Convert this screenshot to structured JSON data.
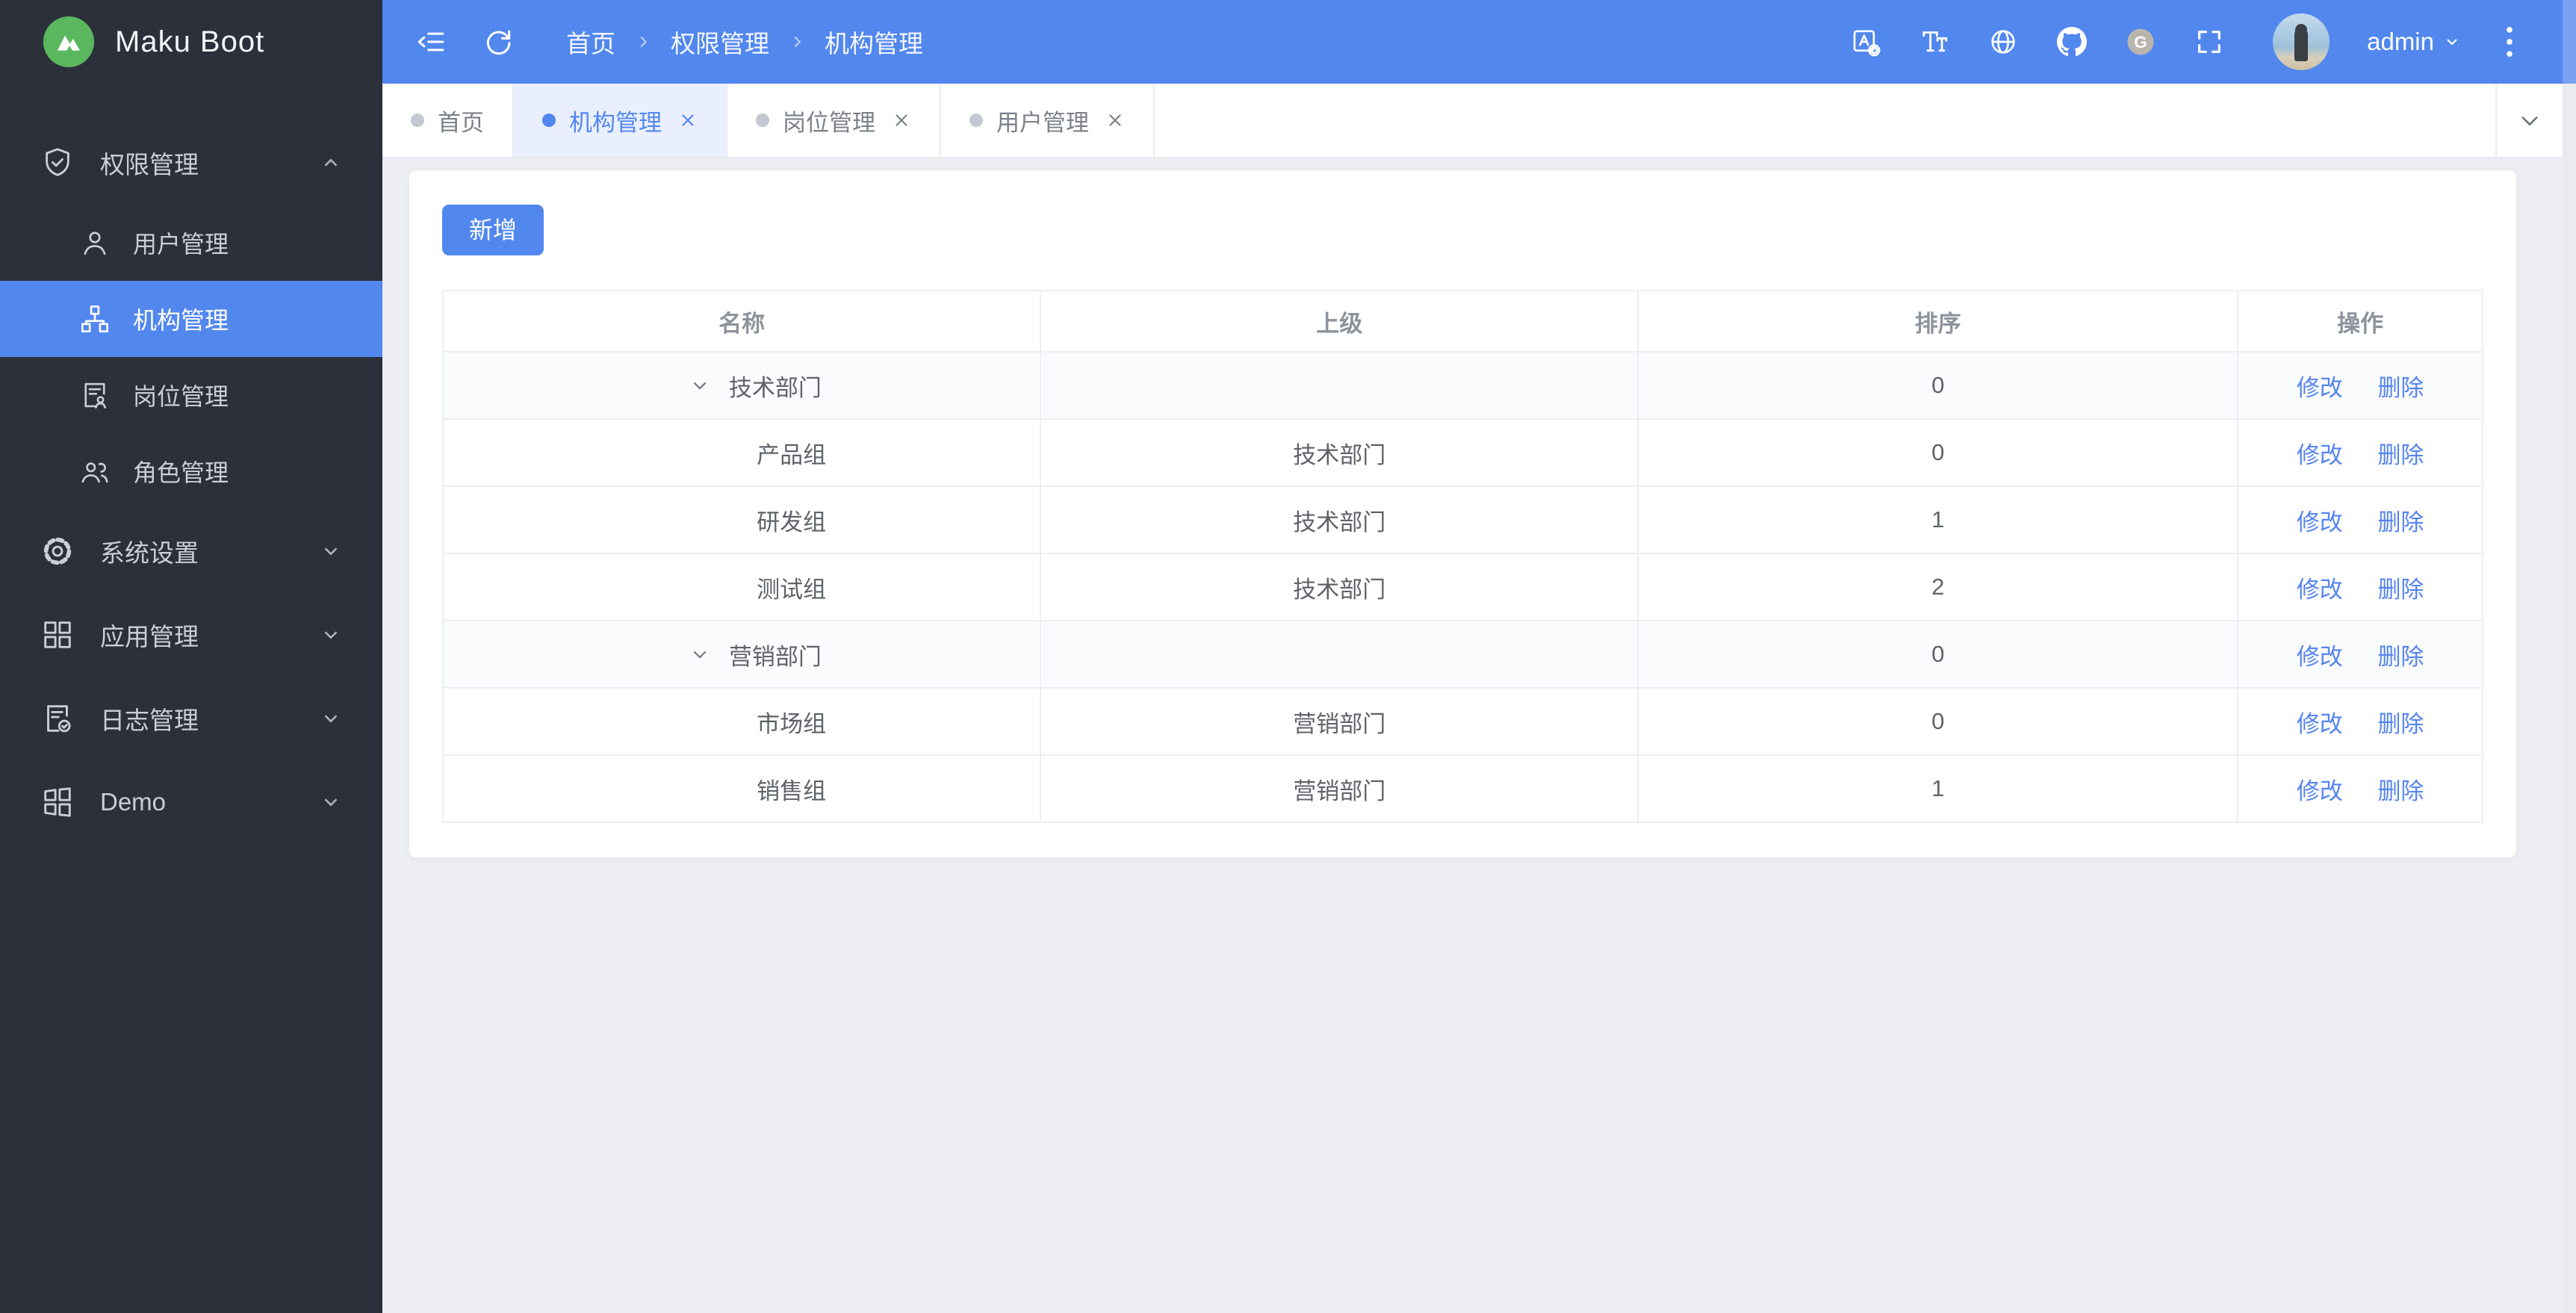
{
  "app": {
    "name": "Maku Boot"
  },
  "colors": {
    "accent": "#5287ee",
    "sidebar_bg": "#2b303b",
    "logo_green": "#5bb75e",
    "gitee_gray": "#b9b5ac",
    "content_bg": "#edeff3"
  },
  "sidebar": {
    "items": [
      {
        "label": "权限管理",
        "icon": "shield-check-icon",
        "expanded": true,
        "children": [
          {
            "label": "用户管理",
            "icon": "user-icon",
            "active": false
          },
          {
            "label": "机构管理",
            "icon": "org-chart-icon",
            "active": true
          },
          {
            "label": "岗位管理",
            "icon": "post-doc-icon",
            "active": false
          },
          {
            "label": "角色管理",
            "icon": "roles-people-icon",
            "active": false
          }
        ]
      },
      {
        "label": "系统设置",
        "icon": "gear-icon",
        "expanded": false
      },
      {
        "label": "应用管理",
        "icon": "grid-icon",
        "expanded": false
      },
      {
        "label": "日志管理",
        "icon": "log-doc-icon",
        "expanded": false
      },
      {
        "label": "Demo",
        "icon": "demo-grid-icon",
        "expanded": false
      }
    ]
  },
  "topbar": {
    "breadcrumb": [
      "首页",
      "权限管理",
      "机构管理"
    ],
    "left_icons": [
      "collapse-menu-icon",
      "refresh-icon"
    ],
    "right_icons": [
      "translate-icon",
      "font-size-icon",
      "globe-icon",
      "github-icon",
      "gitee-icon",
      "fullscreen-icon"
    ],
    "user": {
      "name": "admin"
    }
  },
  "tabs": [
    {
      "label": "首页",
      "active": false,
      "closable": false
    },
    {
      "label": "机构管理",
      "active": true,
      "closable": true
    },
    {
      "label": "岗位管理",
      "active": false,
      "closable": true
    },
    {
      "label": "用户管理",
      "active": false,
      "closable": true
    }
  ],
  "main": {
    "add_button": "新增",
    "table": {
      "headers": [
        "名称",
        "上级",
        "排序",
        "操作"
      ],
      "rows": [
        {
          "name": "技术部门",
          "parent": "",
          "sort": "0",
          "expandable": true,
          "actions": [
            "修改",
            "删除"
          ]
        },
        {
          "name": "产品组",
          "parent": "技术部门",
          "sort": "0",
          "expandable": false,
          "actions": [
            "修改",
            "删除"
          ]
        },
        {
          "name": "研发组",
          "parent": "技术部门",
          "sort": "1",
          "expandable": false,
          "actions": [
            "修改",
            "删除"
          ]
        },
        {
          "name": "测试组",
          "parent": "技术部门",
          "sort": "2",
          "expandable": false,
          "actions": [
            "修改",
            "删除"
          ]
        },
        {
          "name": "营销部门",
          "parent": "",
          "sort": "0",
          "expandable": true,
          "actions": [
            "修改",
            "删除"
          ]
        },
        {
          "name": "市场组",
          "parent": "营销部门",
          "sort": "0",
          "expandable": false,
          "actions": [
            "修改",
            "删除"
          ]
        },
        {
          "name": "销售组",
          "parent": "营销部门",
          "sort": "1",
          "expandable": false,
          "actions": [
            "修改",
            "删除"
          ]
        }
      ]
    }
  }
}
